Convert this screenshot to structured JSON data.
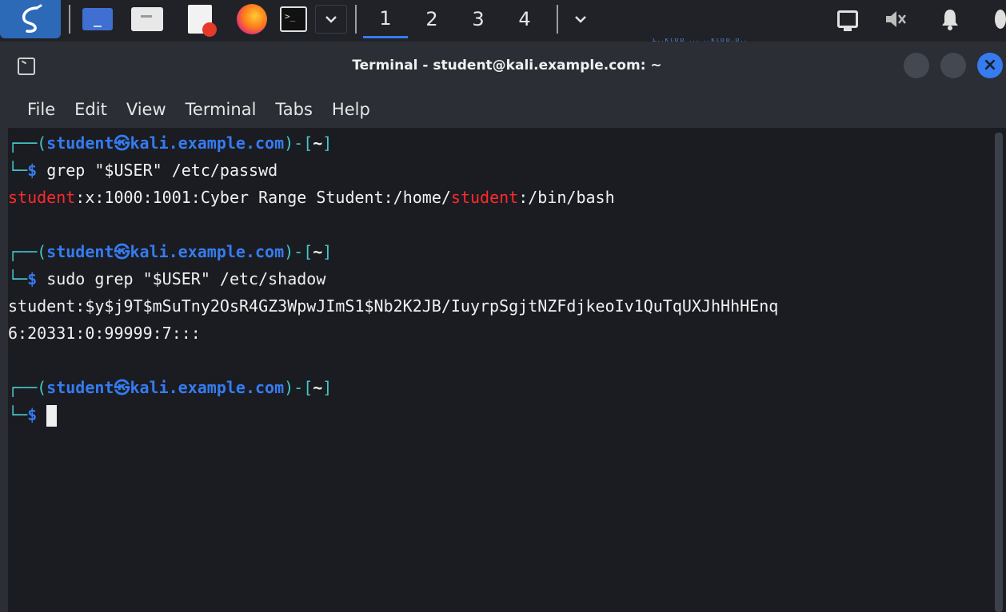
{
  "panel": {
    "workspaces": [
      "1",
      "2",
      "3",
      "4"
    ],
    "active_workspace": "1",
    "workspace_sub": "L..ktop ... ..ktop.o.."
  },
  "window": {
    "title": "Terminal - student@kali.example.com: ~",
    "close_glyph": "×"
  },
  "menu": [
    "File",
    "Edit",
    "View",
    "Terminal",
    "Tabs",
    "Help"
  ],
  "terminal": {
    "prompt_user": "student",
    "prompt_host": "kali.example.com",
    "prompt_dir": "~",
    "commands": [
      "grep \"$USER\" /etc/passwd",
      "sudo grep \"$USER\" /etc/shadow"
    ],
    "passwd_output": {
      "match1": "student",
      "mid": ":x:1000:1001:Cyber Range Student:/home/",
      "match2": "student",
      "end": ":/bin/bash"
    },
    "shadow_output": [
      "student:$y$j9T$mSuTny2OsR4GZ3WpwJImS1$Nb2K2JB/IuyrpSgjtNZFdjkeoIv1QuTqUXJhHhHEnq",
      "6:20331:0:99999:7:::"
    ]
  },
  "colors": {
    "accent": "#367bf0",
    "match": "#ff2a2a",
    "background": "#1a1c22"
  }
}
